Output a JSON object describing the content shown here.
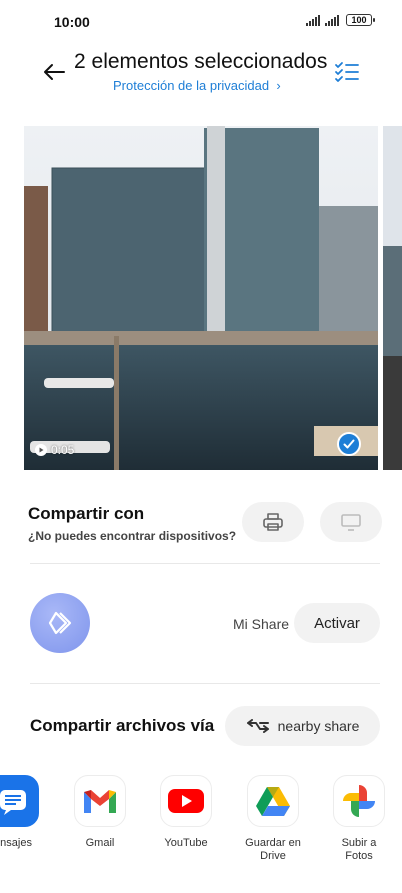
{
  "status_bar": {
    "time": "10:00",
    "battery": "100"
  },
  "header": {
    "title": "2 elementos seleccionados",
    "privacy_link": "Protección de la privacidad"
  },
  "preview": {
    "duration": "0:05",
    "selected": true
  },
  "share_with": {
    "title": "Compartir con",
    "subtitle": "¿No puedes encontrar dispositivos?"
  },
  "mi_share": {
    "label": "Mi Share",
    "activate_label": "Activar"
  },
  "share_via": {
    "title": "Compartir archivos vía",
    "nearby_label": "nearby share"
  },
  "apps": [
    {
      "label": "ensajes",
      "icon": "messages-icon"
    },
    {
      "label": "Gmail",
      "icon": "gmail-icon"
    },
    {
      "label": "YouTube",
      "icon": "youtube-icon"
    },
    {
      "label": "Guardar en Drive",
      "icon": "drive-icon"
    },
    {
      "label": "Subir a Fotos",
      "icon": "photos-icon"
    }
  ],
  "colors": {
    "accent": "#1e7ed6",
    "mishare": "#8fa3f0",
    "button_bg": "#f2f2f2"
  }
}
